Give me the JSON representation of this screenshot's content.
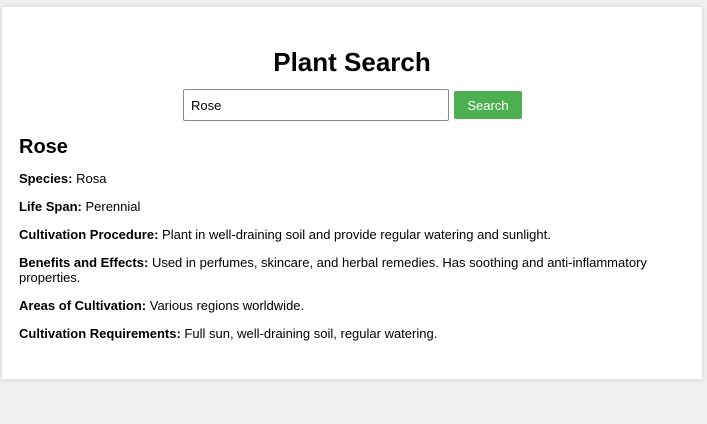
{
  "page": {
    "title": "Plant Search"
  },
  "search": {
    "value": "Rose",
    "placeholder": "",
    "button_label": "Search",
    "button_color": "#4caf50"
  },
  "result": {
    "name": "Rose",
    "fields": [
      {
        "label": "Species:",
        "value": "Rosa"
      },
      {
        "label": "Life Span:",
        "value": "Perennial"
      },
      {
        "label": "Cultivation Procedure:",
        "value": "Plant in well-draining soil and provide regular watering and sunlight."
      },
      {
        "label": "Benefits and Effects:",
        "value": "Used in perfumes, skincare, and herbal remedies. Has soothing and anti-inflammatory properties."
      },
      {
        "label": "Areas of Cultivation:",
        "value": "Various regions worldwide."
      },
      {
        "label": "Cultivation Requirements:",
        "value": "Full sun, well-draining soil, regular watering."
      }
    ]
  }
}
